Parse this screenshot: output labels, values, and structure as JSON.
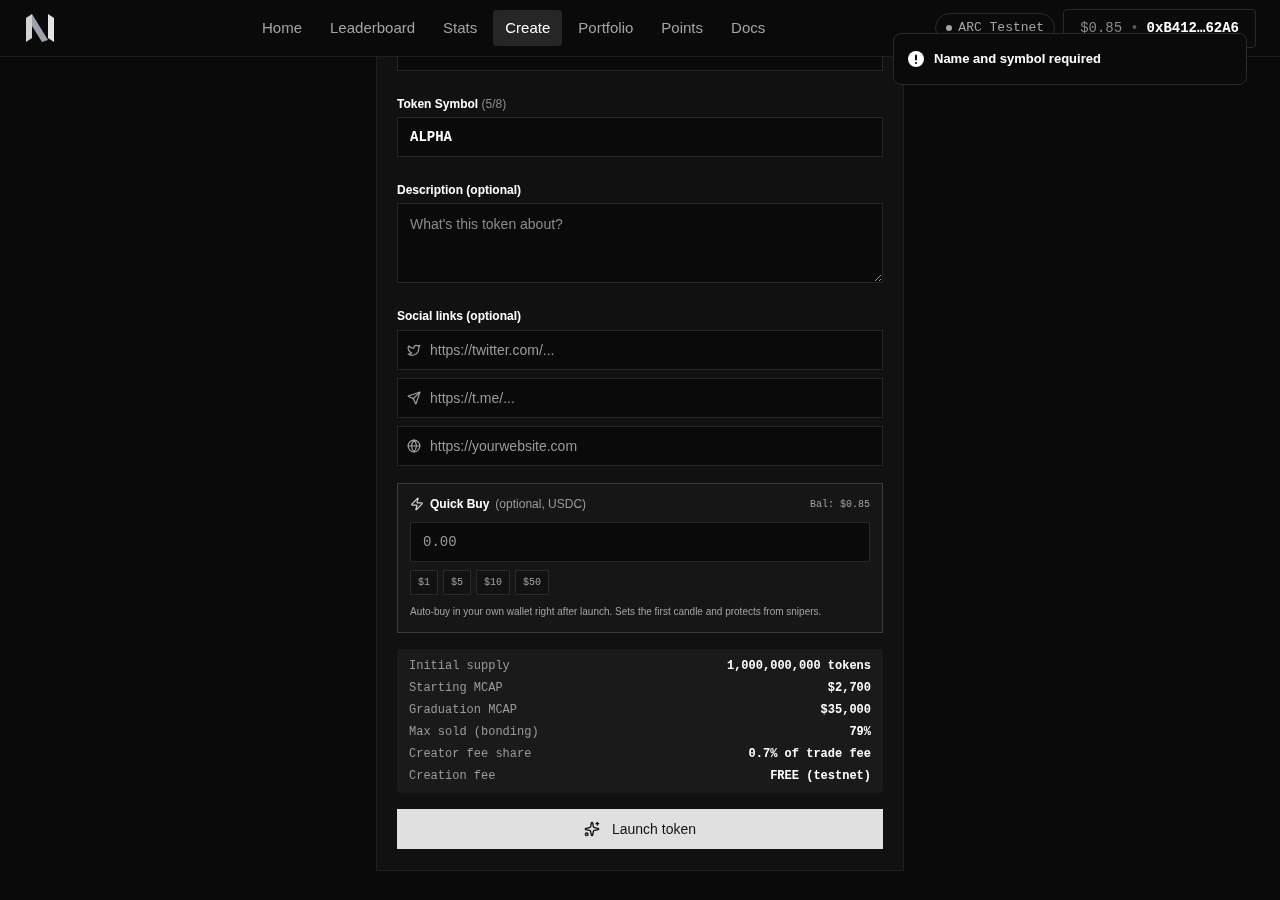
{
  "nav": {
    "items": [
      {
        "label": "Home",
        "selected": false
      },
      {
        "label": "Leaderboard",
        "selected": false
      },
      {
        "label": "Stats",
        "selected": false
      },
      {
        "label": "Create",
        "selected": true
      },
      {
        "label": "Portfolio",
        "selected": false
      },
      {
        "label": "Points",
        "selected": false
      },
      {
        "label": "Docs",
        "selected": false
      }
    ],
    "network": "ARC Testnet",
    "balance": "$0.85",
    "separator": "•",
    "address": "0xB412…62A6"
  },
  "toast": {
    "message": "Name and symbol required"
  },
  "form": {
    "symbol": {
      "label": "Token Symbol",
      "count": "(5/8)",
      "value": "ALPHA"
    },
    "description": {
      "label": "Description (optional)",
      "placeholder": "What's this token about?"
    },
    "social": {
      "label": "Social links (optional)",
      "links": [
        {
          "kind": "twitter",
          "placeholder": "https://twitter.com/..."
        },
        {
          "kind": "telegram",
          "placeholder": "https://t.me/..."
        },
        {
          "kind": "website",
          "placeholder": "https://yourwebsite.com"
        }
      ]
    },
    "quick_buy": {
      "title": "Quick Buy",
      "note": "(optional, USDC)",
      "balance": "Bal: $0.85",
      "placeholder": "0.00",
      "presets": [
        "$1",
        "$5",
        "$10",
        "$50"
      ],
      "hint": "Auto-buy in your own wallet right after launch. Sets the first candle and protects from snipers."
    },
    "stats": [
      {
        "label": "Initial supply",
        "value": "1,000,000,000 tokens"
      },
      {
        "label": "Starting MCAP",
        "value": "$2,700"
      },
      {
        "label": "Graduation MCAP",
        "value": "$35,000"
      },
      {
        "label": "Max sold (bonding)",
        "value": "79%"
      },
      {
        "label": "Creator fee share",
        "value": "0.7% of trade fee"
      },
      {
        "label": "Creation fee",
        "value": "FREE (testnet)"
      }
    ],
    "submit": "Launch token"
  }
}
